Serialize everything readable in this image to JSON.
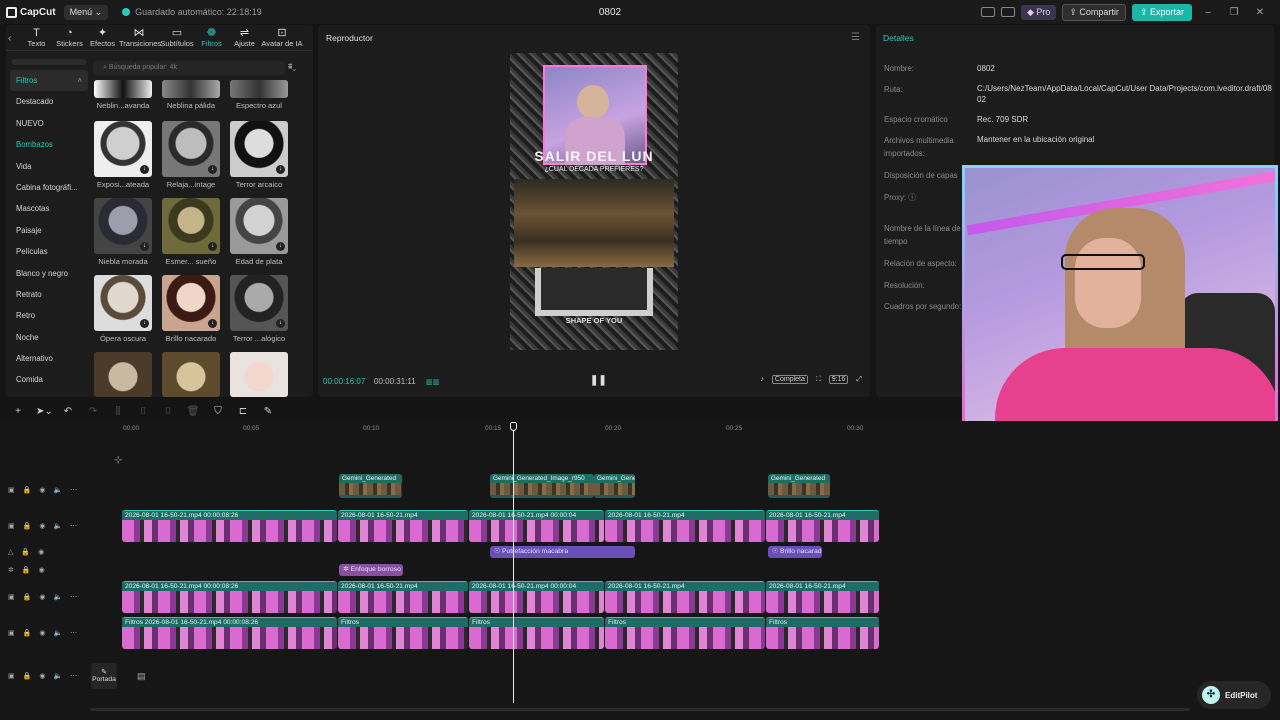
{
  "topbar": {
    "app_name": "CapCut",
    "menu_label": "Menú",
    "autosave_text": "Guardado automático: 22:18:19",
    "project_title": "0802",
    "pro_label": "Pro",
    "share_label": "Compartir",
    "export_label": "Exportar"
  },
  "left_panel": {
    "tools": [
      {
        "label": "Texto",
        "icon": "text-icon"
      },
      {
        "label": "Stickers",
        "icon": "sticker-icon"
      },
      {
        "label": "Efectos",
        "icon": "effects-icon"
      },
      {
        "label": "Transiciones",
        "icon": "transition-icon"
      },
      {
        "label": "Subtítulos",
        "icon": "subtitle-icon"
      },
      {
        "label": "Filtros",
        "icon": "filter-icon"
      },
      {
        "label": "Ajuste",
        "icon": "adjust-icon"
      },
      {
        "label": "Avatar de IA",
        "icon": "avatar-icon"
      }
    ],
    "categories": [
      "Filtros",
      "Destacado",
      "NUEVO",
      "Bombazos",
      "Vida",
      "Cabina fotográfi...",
      "Mascotas",
      "Paisaje",
      "Películas",
      "Blanco y negro",
      "Retrato",
      "Retro",
      "Noche",
      "Alternativo",
      "Comida"
    ],
    "search_placeholder": "Búsqueda popular: 4k",
    "filters": [
      [
        "Neblin...avanda",
        "Neblina pálida",
        "Espectro azul"
      ],
      [
        "Exposi...ateada",
        "Relaja...intage",
        "Terror arcaico"
      ],
      [
        "Niebla morada",
        "Esmer... sueño",
        "Edad de plata"
      ],
      [
        "Ópera oscura",
        "Brillo nacarado",
        "Terror ...alógico"
      ]
    ]
  },
  "player": {
    "title": "Reproductor",
    "current_time": "00:00:16:07",
    "total_time": "00:00:31:11",
    "full_label": "Completa",
    "ratio_label": "9:16",
    "video_title": "SALIR DEL LUN",
    "video_subtitle": "¿CUÁL DÉCADA PREFIERES?",
    "video_footer": "SHAPE OF YOU"
  },
  "details": {
    "title": "Detalles",
    "rows": [
      {
        "label": "Nombre:",
        "value": "0802"
      },
      {
        "label": "Ruta:",
        "value": "C:/Users/NezTeam/AppData/Local/CapCut/User Data/Projects/com.lveditor.draft/0802"
      },
      {
        "label": "Espacio cromático",
        "value": "Rec. 709 SDR"
      },
      {
        "label": "Archivos multimedia importados:",
        "value": "Mantener en la ubicación original"
      },
      {
        "label": "Disposición de capas",
        "value": ""
      },
      {
        "label": "Proxy:",
        "value": ""
      },
      {
        "label": "Nombre de la línea de tiempo",
        "value": ""
      },
      {
        "label": "Relación de aspecto:",
        "value": ""
      },
      {
        "label": "Resolución:",
        "value": ""
      },
      {
        "label": "Cuadros por segundo:",
        "value": ""
      }
    ]
  },
  "timeline": {
    "ruler": [
      "00:00",
      "00:05",
      "00:10",
      "00:15",
      "00:20",
      "00:25",
      "00:30"
    ],
    "cover_label": "Portada",
    "stickers": [
      "Gemini_Generated",
      "Gemini_Generated_Image_r950",
      "Gemini_Gene",
      "Gemini_Generated"
    ],
    "effects": [
      "Putrefacción macabra",
      "Brillo nacarad",
      "Enfoque borroso"
    ],
    "clip_main": "2026-08-01 16-50-21.mp4  00:00:08:26",
    "clip_short": "2026-08-01 16-50-21.mp4",
    "clip_filter_main": "Filtros  2026-08-01 16-50-21.mp4  00:00:08:26",
    "clip_filter_short": "Filtros",
    "clip_mid": "2026-08-01 16-50-21.mp4  00:00:04"
  },
  "editpilot": "EditPilot",
  "colors": {
    "accent": "#2fc7b8",
    "export": "#19b7a8",
    "effect": "#6a4fb8"
  }
}
